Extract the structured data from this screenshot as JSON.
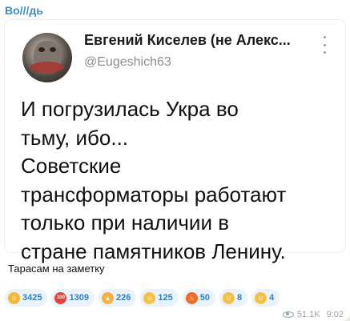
{
  "channel": {
    "author": "Во///дь"
  },
  "tweet": {
    "author_name": "Евгений Киселев (не Алекс...",
    "handle": "@Eugeshich63",
    "lines": [
      "И погрузилась Укра во",
      "тьму, ибо...",
      "Советские",
      "трансформаторы работают",
      "только при наличии в",
      "стране памятников Ленину."
    ]
  },
  "message": {
    "caption": "Тарасам на заметку",
    "views": "51.1K",
    "time": "9:02"
  },
  "reactions": [
    {
      "icon": "rofl-emoji-icon",
      "count": "3425",
      "color": "#f7b733",
      "glyph": "☺"
    },
    {
      "icon": "hundred-emoji-icon",
      "count": "1309",
      "color": "#e8413b",
      "glyph": "100"
    },
    {
      "icon": "thumbs-up-emoji-icon",
      "count": "226",
      "color": "#f6b23d",
      "glyph": "👍"
    },
    {
      "icon": "grin-emoji-icon",
      "count": "125",
      "color": "#f7c244",
      "glyph": "☺"
    },
    {
      "icon": "fire-emoji-icon",
      "count": "50",
      "color": "#f26b21",
      "glyph": "♨"
    },
    {
      "icon": "sunglasses-emoji-icon",
      "count": "8",
      "color": "#f7c244",
      "glyph": "☺"
    },
    {
      "icon": "scream-emoji-icon",
      "count": "4",
      "color": "#f7c244",
      "glyph": "☺"
    }
  ]
}
